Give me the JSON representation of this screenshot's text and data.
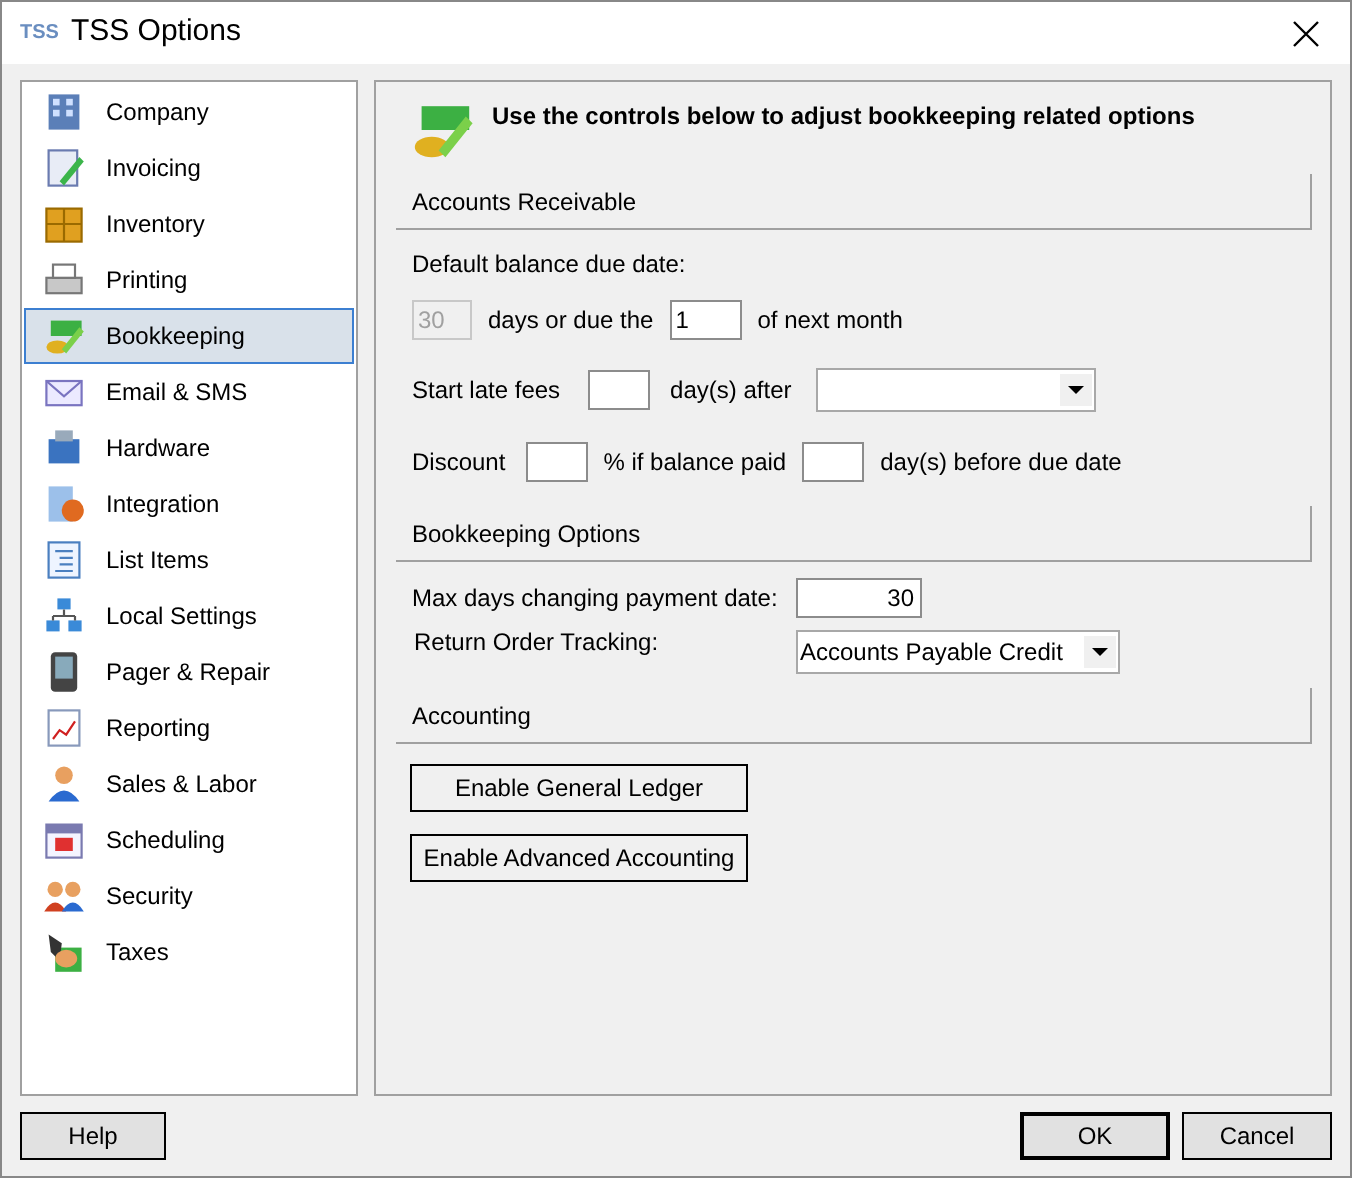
{
  "window": {
    "title": "TSS Options",
    "logo": "TSS"
  },
  "sidebar": {
    "items": [
      {
        "label": "Company",
        "selected": false
      },
      {
        "label": "Invoicing",
        "selected": false
      },
      {
        "label": "Inventory",
        "selected": false
      },
      {
        "label": "Printing",
        "selected": false
      },
      {
        "label": "Bookkeeping",
        "selected": true
      },
      {
        "label": "Email & SMS",
        "selected": false
      },
      {
        "label": "Hardware",
        "selected": false
      },
      {
        "label": "Integration",
        "selected": false
      },
      {
        "label": "List Items",
        "selected": false
      },
      {
        "label": "Local Settings",
        "selected": false
      },
      {
        "label": "Pager & Repair",
        "selected": false
      },
      {
        "label": "Reporting",
        "selected": false
      },
      {
        "label": "Sales & Labor",
        "selected": false
      },
      {
        "label": "Scheduling",
        "selected": false
      },
      {
        "label": "Security",
        "selected": false
      },
      {
        "label": "Taxes",
        "selected": false
      }
    ]
  },
  "header": "Use the controls below to adjust bookkeeping related options",
  "accounts_receivable": {
    "title": "Accounts Receivable",
    "default_label": "Default balance due date:",
    "days_field": {
      "value": "30",
      "disabled": true
    },
    "days_text": "days or due the",
    "day_field": {
      "value": "1",
      "disabled": false
    },
    "month_text": "of next month",
    "late_fees_label": "Start late fees",
    "after_text": "day(s) after",
    "discount_label": "Discount",
    "percent_text": "% if balance paid",
    "before_text": "day(s) before due date"
  },
  "bookkeeping_options": {
    "title": "Bookkeeping Options",
    "max_days_label": "Max days changing payment date:",
    "max_days_value": "30",
    "return_label": "Return Order Tracking:",
    "return_value": "Accounts Payable Credit"
  },
  "accounting": {
    "title": "Accounting",
    "buttons": [
      "Enable General Ledger",
      "Enable Advanced Accounting"
    ]
  },
  "footer": {
    "help": "Help",
    "ok": "OK",
    "cancel": "Cancel"
  }
}
